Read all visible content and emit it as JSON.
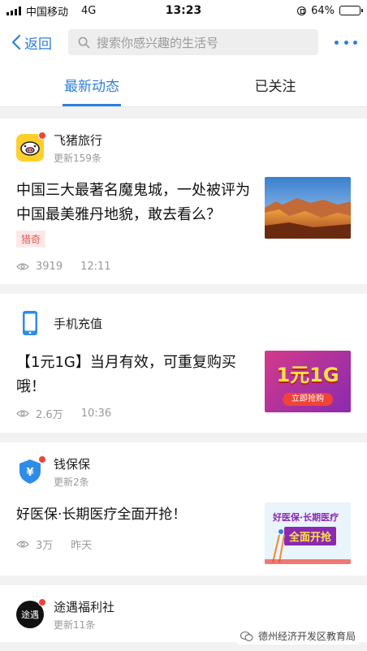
{
  "status_bar": {
    "carrier": "中国移动",
    "network": "4G",
    "time": "13:23",
    "battery": "64%",
    "battery_level": 0.64
  },
  "nav": {
    "back_label": "返回",
    "search_placeholder": "搜索你感兴趣的生活号"
  },
  "tabs": [
    {
      "label": "最新动态",
      "active": true
    },
    {
      "label": "已关注",
      "active": false
    }
  ],
  "cards": [
    {
      "account": "飞猪旅行",
      "updates": "更新159条",
      "headline": "中国三大最著名魔鬼城，一处被评为中国最美雅丹地貌，敢去看么？",
      "tag": "猎奇",
      "views": "3919",
      "time": "12:11"
    },
    {
      "account": "手机充值",
      "updates": "",
      "headline": "【1元1G】当月有效，可重复购买哦！",
      "views": "2.6万",
      "time": "10:36",
      "thumb_text": "1元1G",
      "thumb_button": "立即抢购"
    },
    {
      "account": "钱保保",
      "updates": "更新2条",
      "headline": "好医保·长期医疗全面开抢！",
      "views": "3万",
      "time": "昨天",
      "thumb_line1": "好医保·长期医疗",
      "thumb_line2": "全面开抢"
    },
    {
      "account": "途遇福利社",
      "updates": "更新11条",
      "avatar_text": "途遇"
    }
  ],
  "watermark": "德州经济开发区教育局",
  "colors": {
    "accent": "#2f7fd8",
    "badge": "#f0433a",
    "tag": "#e25a5a"
  }
}
